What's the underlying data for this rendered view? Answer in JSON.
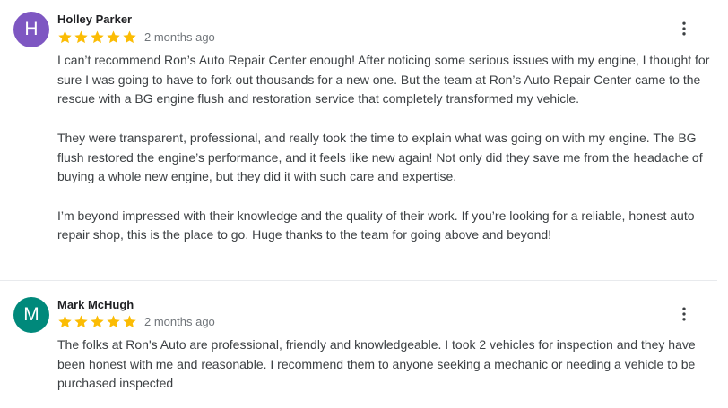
{
  "colors": {
    "star": "#fbbc04",
    "divider": "#e8eaed"
  },
  "reviews": [
    {
      "avatar_letter": "H",
      "avatar_color": "#7e57c2",
      "name": "Holley Parker",
      "rating": 5,
      "date": "2 months ago",
      "menu_icon": "more-vert-icon",
      "text": "I can’t recommend Ron’s Auto Repair Center enough! After noticing some serious issues with my engine, I thought for sure I was going to have to fork out thousands for a new one. But the team at Ron’s Auto Repair Center came to the rescue with a BG engine flush and restoration service that completely transformed my vehicle.\n\nThey were transparent, professional, and really took the time to explain what was going on with my engine. The BG flush restored the engine’s performance, and it feels like new again! Not only did they save me from the headache of buying a whole new engine, but they did it with such care and expertise.\n\nI’m beyond impressed with their knowledge and the quality of their work. If you’re looking for a reliable, honest auto repair shop, this is the place to go. Huge thanks to the team for going above and beyond!"
    },
    {
      "avatar_letter": "M",
      "avatar_color": "#00897b",
      "name": "Mark McHugh",
      "rating": 5,
      "date": "2 months ago",
      "menu_icon": "more-vert-icon",
      "text": "The folks at Ron's Auto are professional, friendly and knowledgeable. I took 2 vehicles for inspection and they have been honest with me and reasonable. I recommend them to anyone seeking a mechanic or needing a vehicle to be purchased inspected"
    }
  ]
}
